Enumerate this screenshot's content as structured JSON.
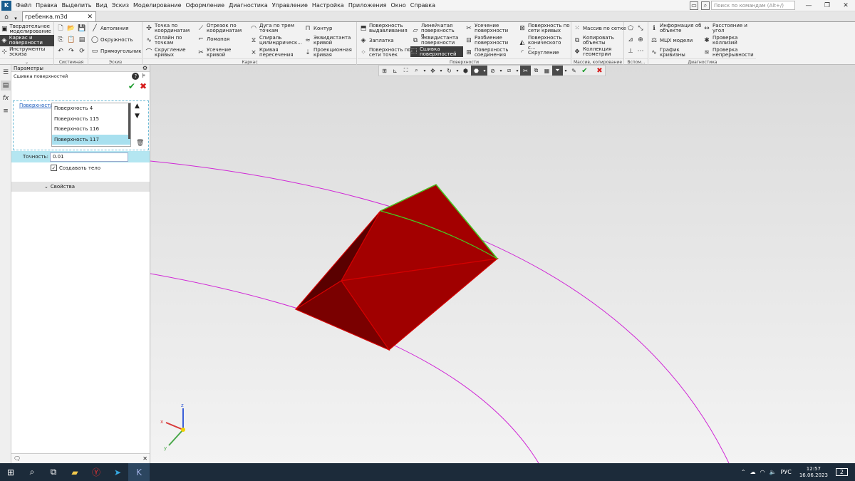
{
  "menubar": {
    "items": [
      "Файл",
      "Правка",
      "Выделить",
      "Вид",
      "Эскиз",
      "Моделирование",
      "Оформление",
      "Диагностика",
      "Управление",
      "Настройка",
      "Приложения",
      "Окно",
      "Справка"
    ],
    "search_placeholder": "Поиск по командам (Alt+/)"
  },
  "tabs": {
    "doc_name": "гребенка.m3d"
  },
  "ribbon": {
    "modes": [
      "Твердотельное моделирование",
      "Каркас и поверхности",
      "Инструменты эскиза"
    ],
    "groups": {
      "system": "Системная",
      "sketch": "Эскиз",
      "frame": "Каркас",
      "surfaces": "Поверхности",
      "array": "Массив, копирование",
      "aux": "Вспом...",
      "diag": "Диагностика"
    },
    "sketch_buttons": [
      "Автолиния",
      "Окружность",
      "Прямоугольник"
    ],
    "frame_buttons": [
      "Точка по координатам",
      "Сплайн по точкам",
      "Скругление кривых",
      "Отрезок по координатам",
      "Ломаная",
      "Усечение кривой",
      "Дуга по трем точкам",
      "Спираль цилиндрическ...",
      "Кривая пересечения",
      "Контур",
      "Эквидистанта кривой",
      "Проекционная кривая"
    ],
    "surface_buttons": [
      "Поверхность выдавливания",
      "Заплатка",
      "Поверхность по сети точек",
      "Линейчатая поверхность п...",
      "Эквидистанта поверхности",
      "Сшивка поверхностей",
      "Усечение поверхности",
      "Разбиение поверхности",
      "Поверхность соединения",
      "Поверхность по сети кривых",
      "Поверхность конического с...",
      "Скругление"
    ],
    "array_buttons": [
      "Массив по сетке",
      "Копировать объекты",
      "Коллекция геометрии"
    ],
    "diag_buttons": [
      "Информация об объекте",
      "МЦХ модели",
      "График кривизны",
      "Расстояние и угол",
      "Проверка коллизий",
      "Проверка непрерывности"
    ]
  },
  "panel": {
    "header": "Параметры",
    "operation": "Сшивка поверхностей",
    "surfaces_label": "Поверхности",
    "surfaces": [
      "Поверхность 4",
      "Поверхность 115",
      "Поверхность 116",
      "Поверхность 117"
    ],
    "accuracy_label": "Точность:",
    "accuracy_value": "0.01",
    "create_body": "Создавать тело",
    "properties": "Свойства"
  },
  "taskbar": {
    "lang": "РУС",
    "time": "12:57",
    "date": "16.06.2023",
    "notif_count": "2"
  },
  "colors": {
    "solid": "#a80000",
    "edge_green": "#44cc22",
    "curve": "#d028d6",
    "accent": "#a8e0ef"
  }
}
